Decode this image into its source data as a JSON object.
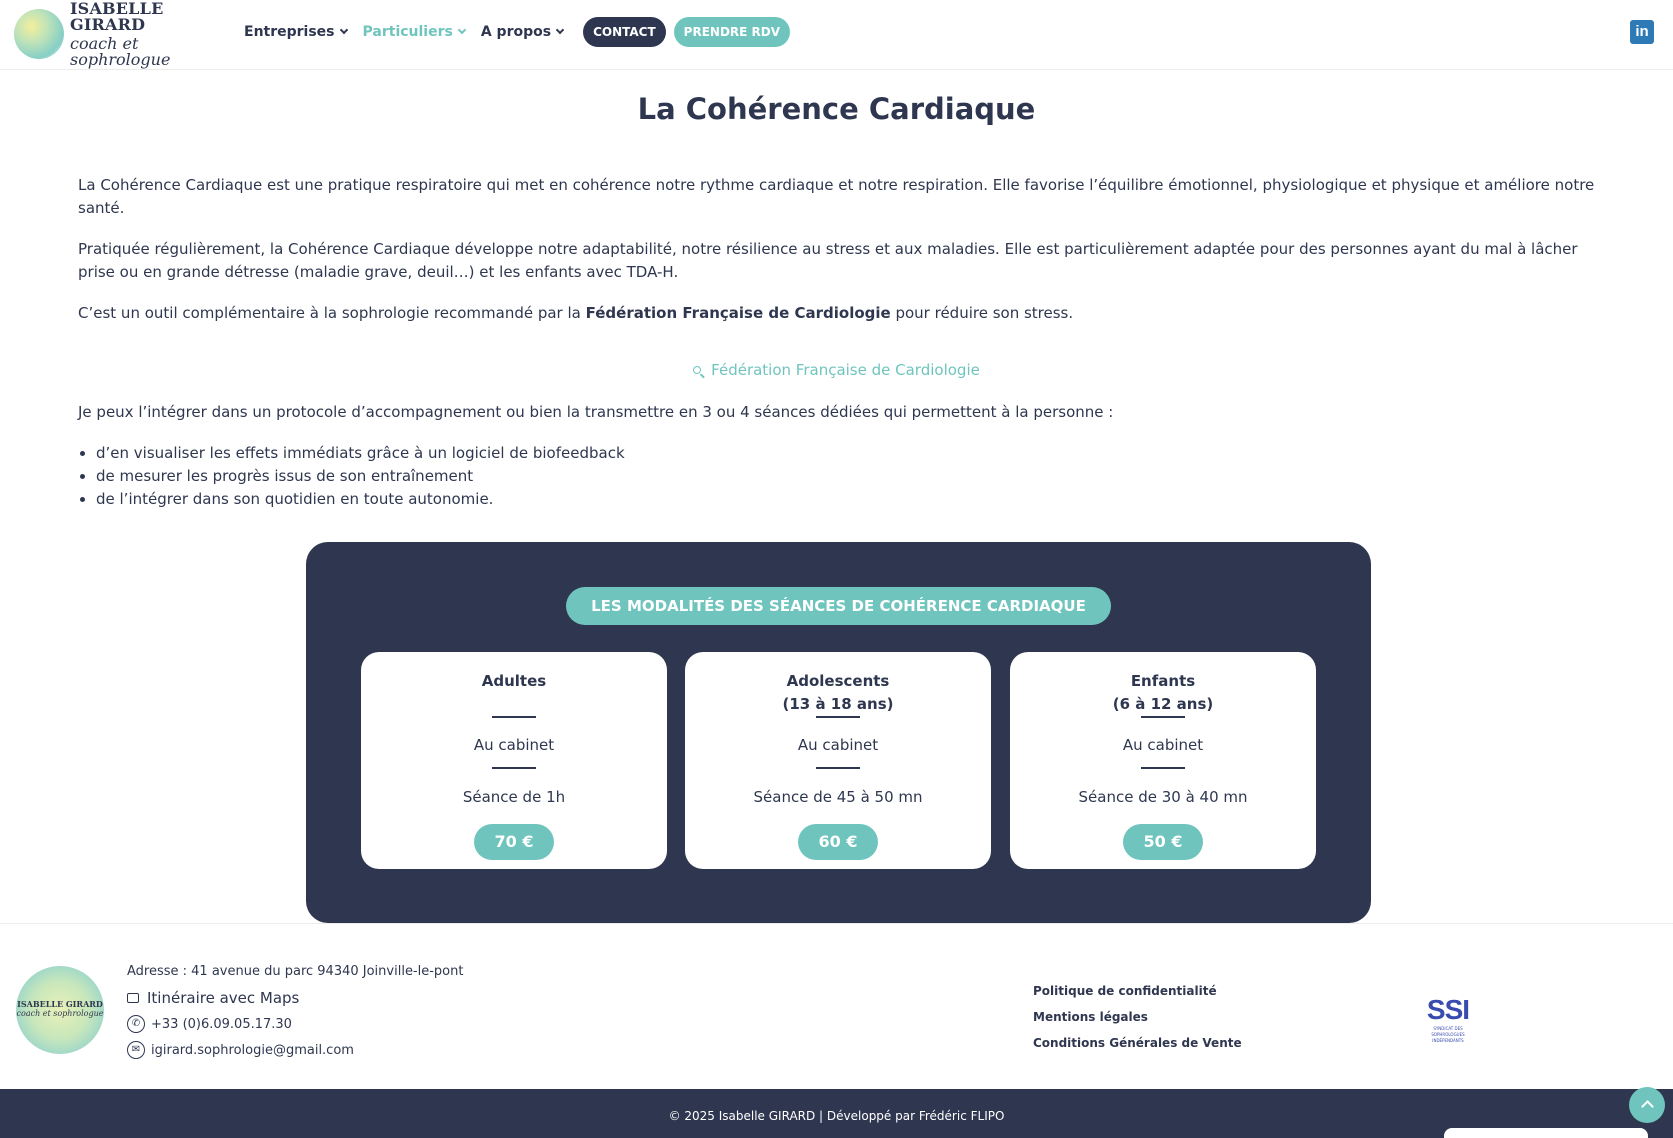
{
  "header": {
    "logo_name": "ISABELLE GIRARD",
    "logo_sub": "coach et sophrologue",
    "nav": [
      {
        "label": "Entreprises"
      },
      {
        "label": "Particuliers"
      },
      {
        "label": "A propos"
      }
    ],
    "contact_label": "CONTACT",
    "rdv_label": "PRENDRE RDV",
    "linkedin_icon": "linkedin-icon",
    "linkedin_glyph": "in"
  },
  "colors": {
    "navy": "#2f3750",
    "teal": "#6fc5be"
  },
  "main": {
    "title": "La Cohérence Cardiaque",
    "p1": "La Cohérence Cardiaque est une pratique respiratoire qui met en cohérence notre rythme cardiaque et notre respiration. Elle favorise l’équilibre émotionnel, physiologique et physique et améliore notre santé.",
    "p2": "Pratiquée régulièrement, la Cohérence Cardiaque développe notre adaptabilité, notre résilience au stress et aux maladies. Elle est particulièrement adaptée pour des personnes ayant du mal à lâcher prise ou en grande détresse (maladie grave, deuil…) et les enfants avec TDA-H.",
    "p3_before": "C’est un outil complémentaire à la sophrologie recommandé par la ",
    "p3_strong": "Fédération Française de Cardiologie",
    "p3_after": " pour réduire son stress.",
    "ffc_link": "Fédération Française de Cardiologie",
    "p4": "Je peux l’intégrer dans un protocole d’accompagnement ou bien la transmettre en 3 ou 4 séances dédiées qui permettent à la personne :",
    "bullets": [
      "d’en visualiser les effets immédiats grâce à un logiciel de biofeedback",
      "de mesurer les progrès issus de son entraînement",
      "de l’intégrer dans son quotidien en toute autonomie."
    ]
  },
  "panel": {
    "badge": "LES MODALITÉS DES SÉANCES DE COHÉRENCE CARDIAQUE",
    "cards": [
      {
        "title": "Adultes",
        "subtitle": "",
        "place": "Au cabinet",
        "duration": "Séance de 1h",
        "price": "70 €"
      },
      {
        "title": "Adolescents",
        "subtitle": "(13 à 18 ans)",
        "place": "Au cabinet",
        "duration": "Séance de 45 à 50 mn",
        "price": "60 €"
      },
      {
        "title": "Enfants",
        "subtitle": "(6 à 12 ans)",
        "place": "Au cabinet",
        "duration": "Séance de 30 à 40 mn",
        "price": "50 €"
      }
    ]
  },
  "footer": {
    "logo_name": "ISABELLE GIRARD",
    "logo_sub": "coach et sophrologue",
    "address": "Adresse : 41 avenue du parc 94340 Joinville-le-pont",
    "maps": "Itinéraire avec Maps",
    "phone": "+33 (0)6.09.05.17.30",
    "email": "igirard.sophrologie@gmail.com",
    "legal": [
      "Politique de confidentialité",
      "Mentions légales",
      "Conditions Générales de Vente"
    ],
    "ssi_logo": "SSI",
    "ssi_sub": "SYNDICAT DES SOPHROLOGUES INDÉPENDANTS",
    "copyright": "© 2025 Isabelle GIRARD | Développé par Frédéric FLIPO"
  }
}
